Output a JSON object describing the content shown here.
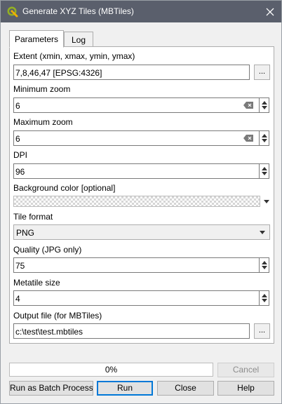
{
  "window": {
    "title": "Generate XYZ Tiles (MBTiles)",
    "icon": "qgis-logo-icon"
  },
  "tabs": [
    {
      "label": "Parameters",
      "active": true
    },
    {
      "label": "Log",
      "active": false
    }
  ],
  "parameters": {
    "extent": {
      "label": "Extent (xmin, xmax, ymin, ymax)",
      "value": "7,8,46,47 [EPSG:4326]",
      "button": "..."
    },
    "min_zoom": {
      "label": "Minimum zoom",
      "value": "6"
    },
    "max_zoom": {
      "label": "Maximum zoom",
      "value": "6"
    },
    "dpi": {
      "label": "DPI",
      "value": "96"
    },
    "background": {
      "label": "Background color [optional]"
    },
    "tile_format": {
      "label": "Tile format",
      "value": "PNG"
    },
    "quality": {
      "label": "Quality (JPG only)",
      "value": "75"
    },
    "metatile": {
      "label": "Metatile size",
      "value": "4"
    },
    "output": {
      "label": "Output file (for MBTiles)",
      "value": "c:\\test\\test.mbtiles",
      "button": "..."
    }
  },
  "progress": {
    "text": "0%",
    "value": 0
  },
  "buttons": {
    "cancel": "Cancel",
    "batch": "Run as Batch Process...",
    "run": "Run",
    "close": "Close",
    "help": "Help"
  }
}
